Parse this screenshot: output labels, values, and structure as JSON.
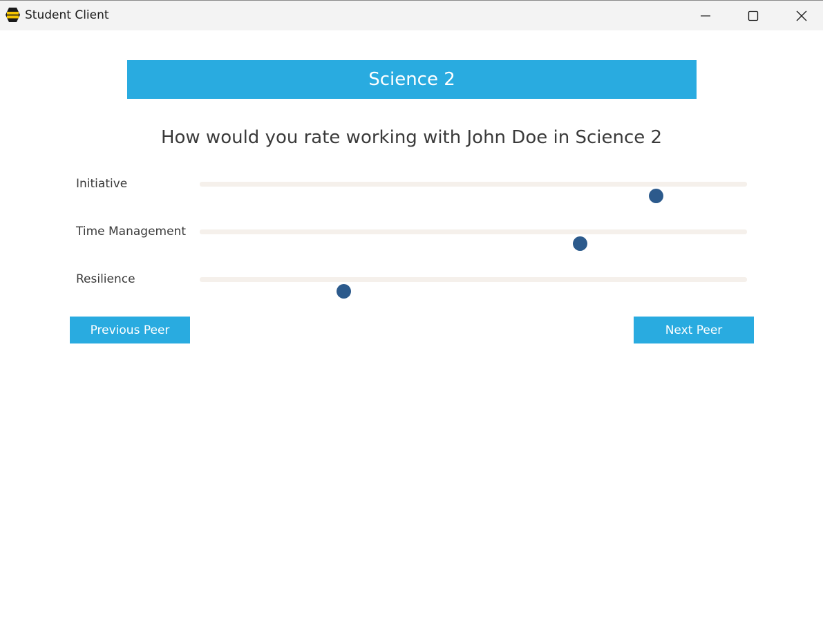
{
  "window": {
    "title": "Student Client",
    "icon": "hexagon-app-icon",
    "controls": [
      "minimize-icon",
      "maximize-icon",
      "close-icon"
    ]
  },
  "course": {
    "title": "Science 2"
  },
  "question": "How would you rate working with John Doe in Science 2",
  "ratings": [
    {
      "label": "Initiative",
      "value_fraction": 0.833
    },
    {
      "label": "Time Management",
      "value_fraction": 0.694
    },
    {
      "label": "Resilience",
      "value_fraction": 0.263
    }
  ],
  "buttons": {
    "previous": "Previous Peer",
    "next": "Next Peer"
  },
  "colors": {
    "accent": "#29abe0",
    "slider_thumb": "#2c5a8c",
    "slider_track": "#f5f0eb"
  }
}
